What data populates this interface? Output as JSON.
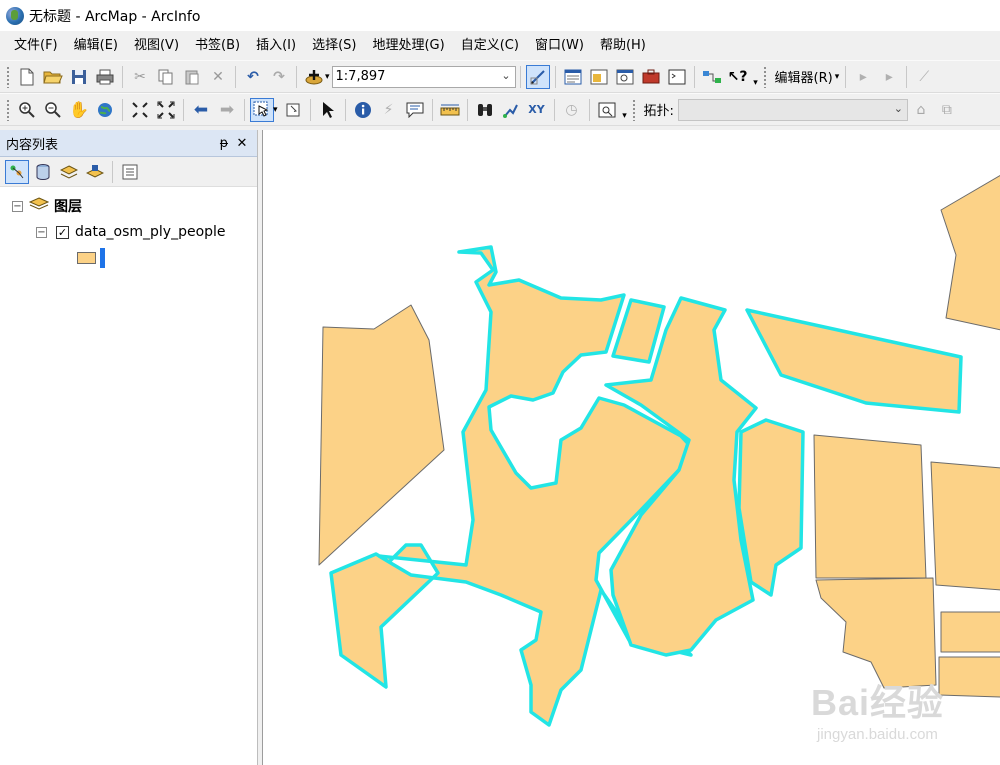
{
  "window": {
    "title": "无标题 - ArcMap - ArcInfo"
  },
  "menu": [
    "文件(F)",
    "编辑(E)",
    "视图(V)",
    "书签(B)",
    "插入(I)",
    "选择(S)",
    "地理处理(G)",
    "自定义(C)",
    "窗口(W)",
    "帮助(H)"
  ],
  "toolbar1": {
    "scale": "1:7,897",
    "editor_label": "编辑器(R)"
  },
  "toolbar2": {
    "topology_label": "拓扑:"
  },
  "toc": {
    "title": "内容列表",
    "pin_glyph": "ᵽ",
    "close_glyph": "✕",
    "group_label": "图层",
    "layer_name": "data_osm_ply_people",
    "checked": true
  },
  "map": {
    "fill_color": "#fcd287",
    "outline_color": "#6b6b6b",
    "selection_color": "#22e5e5"
  },
  "watermark": {
    "brand": "Bai经验",
    "url": "jingyan.baidu.com"
  }
}
